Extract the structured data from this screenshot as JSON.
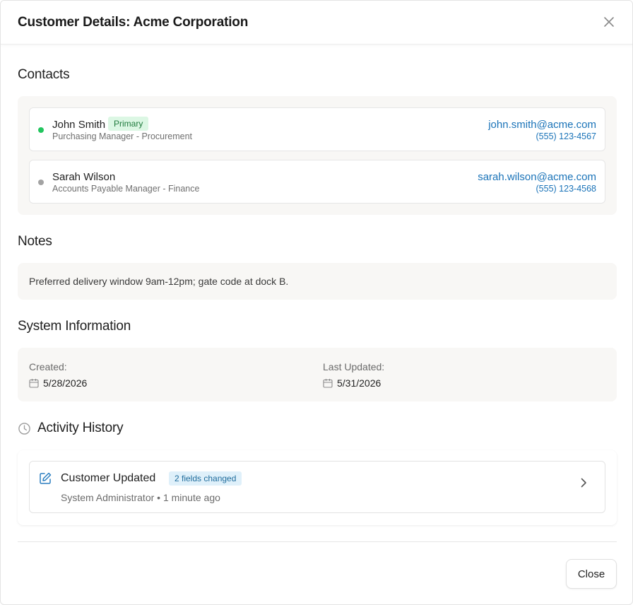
{
  "header": {
    "title": "Customer Details: Acme Corporation"
  },
  "contacts": {
    "title": "Contacts",
    "items": [
      {
        "name": "John Smith",
        "badge": "Primary",
        "role": "Purchasing Manager - Procurement",
        "email": "john.smith@acme.com",
        "phone": "(555) 123-4567",
        "status_color": "#22c55e"
      },
      {
        "name": "Sarah Wilson",
        "badge": "",
        "role": "Accounts Payable Manager - Finance",
        "email": "sarah.wilson@acme.com",
        "phone": "(555) 123-4568",
        "status_color": "#a3a3a3"
      }
    ]
  },
  "notes": {
    "title": "Notes",
    "text": "Preferred delivery window 9am-12pm; gate code at dock B."
  },
  "system": {
    "title": "System Information",
    "created_label": "Created:",
    "created_value": "5/28/2026",
    "updated_label": "Last Updated:",
    "updated_value": "5/31/2026"
  },
  "activity": {
    "title": "Activity History",
    "items": [
      {
        "title": "Customer Updated",
        "badge": "2 fields changed",
        "meta": "System Administrator • 1 minute ago"
      }
    ]
  },
  "footer": {
    "close_label": "Close"
  },
  "colors": {
    "link": "#1a73b8",
    "primary_badge_bg": "#dcf7e4",
    "fields_badge_bg": "#dff0fa",
    "panel_bg": "#f8f7f5"
  }
}
